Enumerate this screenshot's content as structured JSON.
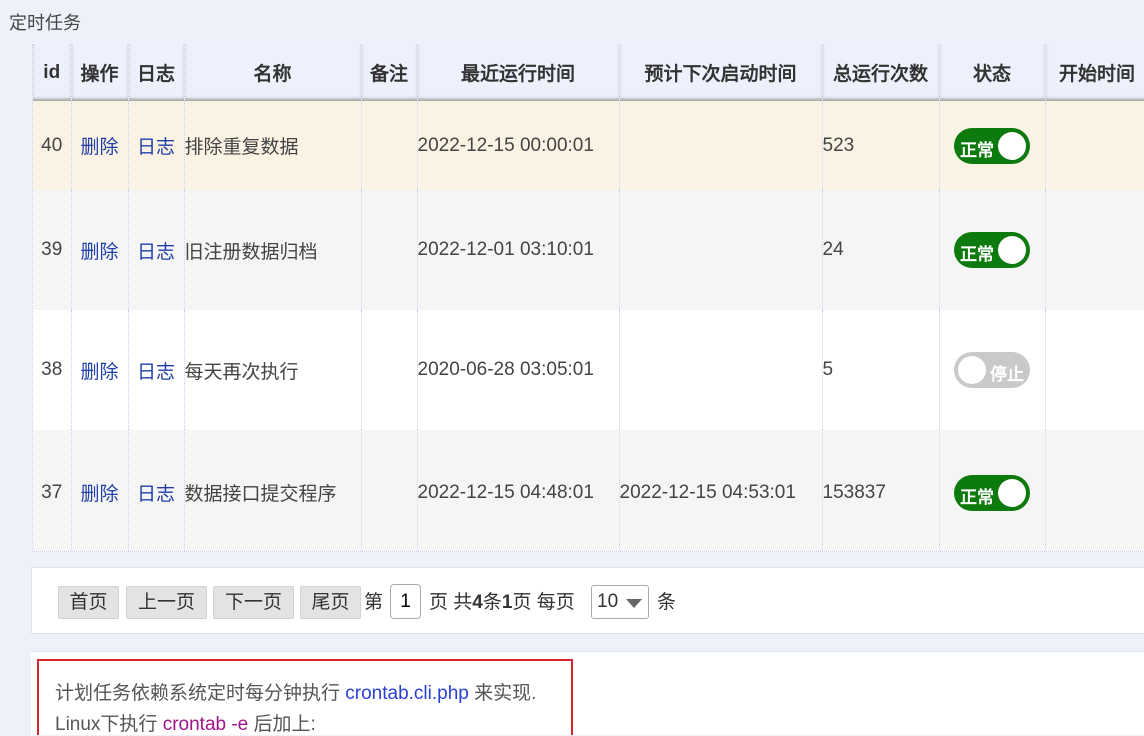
{
  "page": {
    "title": "定时任务"
  },
  "table": {
    "headers": [
      "id",
      "操作",
      "日志",
      "名称",
      "备注",
      "最近运行时间",
      "预计下次启动时间",
      "总运行次数",
      "状态",
      "开始时间"
    ],
    "rows": [
      {
        "id": "40",
        "op": "删除",
        "log": "日志",
        "name": "排除重复数据",
        "note": "",
        "last_run": "2022-12-15 00:00:01",
        "next_run": "",
        "count": "523",
        "status": "正常",
        "status_on": true,
        "start": ""
      },
      {
        "id": "39",
        "op": "删除",
        "log": "日志",
        "name": "旧注册数据归档",
        "note": "",
        "last_run": "2022-12-01 03:10:01",
        "next_run": "",
        "count": "24",
        "status": "正常",
        "status_on": true,
        "start": ""
      },
      {
        "id": "38",
        "op": "删除",
        "log": "日志",
        "name": "每天再次执行",
        "note": "",
        "last_run": "2020-06-28 03:05:01",
        "next_run": "",
        "count": "5",
        "status": "停止",
        "status_on": false,
        "start": ""
      },
      {
        "id": "37",
        "op": "删除",
        "log": "日志",
        "name": "数据接口提交程序",
        "note": "",
        "last_run": "2022-12-15 04:48:01",
        "next_run": "2022-12-15 04:53:01",
        "count": "153837",
        "status": "正常",
        "status_on": true,
        "start": ""
      }
    ]
  },
  "pager": {
    "first": "首页",
    "prev": "上一页",
    "next": "下一页",
    "last": "尾页",
    "page_prefix": "第",
    "page_value": "1",
    "page_suffix": "页 共",
    "total_rows": "4",
    "rows_unit": "条",
    "total_pages": "1",
    "pages_unit": "页 每页",
    "page_size": "10",
    "size_unit": "条"
  },
  "note": {
    "line1_prefix": "计划任务依赖系统定时每分钟执行 ",
    "line1_file": "crontab.cli.php",
    "line1_suffix": " 来实现.",
    "line2_prefix": "Linux下执行 ",
    "line2_cmd": "crontab -e",
    "line2_suffix": " 后加上:"
  },
  "colors": {
    "status_on": "#0c7a0c",
    "status_off": "#c9c9c9",
    "link": "#1f3fa8",
    "highlight_row": "#faf3e3",
    "note_border": "#d6262c"
  }
}
